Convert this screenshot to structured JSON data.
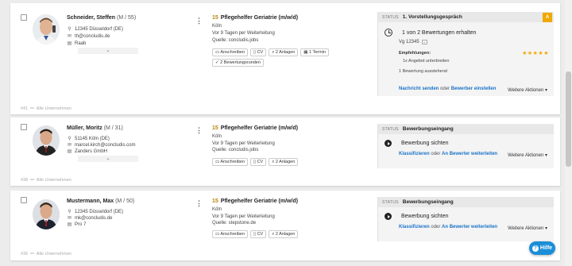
{
  "candidates": [
    {
      "name": "Schneider, Steffen",
      "meta": "(M / 55)",
      "address": "12345 Düsseldorf (DE)",
      "email": "th@concludis.de",
      "company": "Raab",
      "footer_id": "#41",
      "footer_label": "Alle Unternehmen",
      "job": {
        "number": "15",
        "title": "Pflegehelfer Geriatrie (m/w/d)",
        "location": "Köln",
        "since": "Vor 9 Tagen per Weiterleitung",
        "source": "Quelle: concludis.jobs",
        "chips": [
          "Anschreiben",
          "CV",
          "2 Anlagen",
          "1 Termin",
          "2 Bewertungsrunden"
        ]
      },
      "status": {
        "label": "STATUS",
        "value": "1. Vorstellungsgespräch",
        "badge": "A",
        "main_text": "1 von 2 Bewertungen erhalten",
        "sub_text": "Vg 12345",
        "recommend_label": "Empfehlungen:",
        "stars": "★★★★★",
        "bullet": "1x Angebot unterbreiten",
        "pending": "1 Bewertung ausstehend",
        "link1": "Nachricht senden",
        "or": "oder",
        "link2": "Bewerber einstellen",
        "more": "Weitere Aktionen ▾"
      }
    },
    {
      "name": "Müller, Moritz",
      "meta": "(M / 31)",
      "address": "51145 Köln (DE)",
      "email": "marcel.kirch@concludis.com",
      "company": "Zanders GmbH",
      "footer_id": "#38",
      "footer_label": "Alle Unternehmen",
      "job": {
        "number": "15",
        "title": "Pflegehelfer Geriatrie (m/w/d)",
        "location": "Köln",
        "since": "Vor 9 Tagen per Weiterleitung",
        "source": "Quelle: concludis.jobs",
        "chips": [
          "Anschreiben",
          "CV",
          "2 Anlagen"
        ]
      },
      "status": {
        "label": "STATUS",
        "value": "Bewerbungseingang",
        "main_text": "Bewerbung sichten",
        "link1": "Klassifizieren",
        "or": "oder",
        "link2": "An Bewerter weiterleiten",
        "more": "Weitere Aktionen ▾"
      }
    },
    {
      "name": "Mustermann, Max",
      "meta": "(M / 50)",
      "address": "12345 Düsseldorf (DE)",
      "email": "mk@concludis.de",
      "company": "Pro 7",
      "footer_id": "#36",
      "footer_label": "Alle Unternehmen",
      "job": {
        "number": "15",
        "title": "Pflegehelfer Geriatrie (m/w/d)",
        "location": "Köln",
        "since": "Vor 9 Tagen per Weiterleitung",
        "source": "Quelle: stepstone.de",
        "chips": [
          "Anschreiben",
          "CV",
          "2 Anlagen"
        ]
      },
      "status": {
        "label": "STATUS",
        "value": "Bewerbungseingang",
        "main_text": "Bewerbung sichten",
        "link1": "Klassifizieren",
        "or": "oder",
        "link2": "An Bewerter weiterleiten",
        "more": "Weitere Aktionen ▾"
      }
    }
  ],
  "help_label": "Hilfe",
  "icons": {
    "location": "location-pin-icon",
    "email": "envelope-icon",
    "company": "building-icon",
    "expand": "chevron-down-icon",
    "menu": "kebab-menu-icon",
    "clock": "clock-icon",
    "play": "play-icon"
  },
  "colors": {
    "accent": "#1a73c8",
    "warning": "#f0a800",
    "help": "#1a8ed8"
  }
}
